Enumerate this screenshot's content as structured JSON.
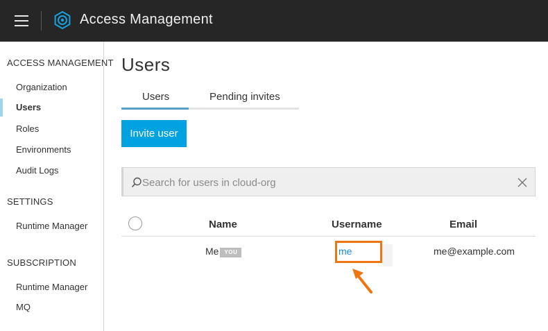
{
  "header": {
    "title": "Access Management",
    "bg_color": "#262626"
  },
  "sidebar": {
    "sections": [
      {
        "heading": "ACCESS MANAGEMENT",
        "items": [
          {
            "label": "Organization",
            "active": false
          },
          {
            "label": "Users",
            "active": true
          },
          {
            "label": "Roles",
            "active": false
          },
          {
            "label": "Environments",
            "active": false
          },
          {
            "label": "Audit Logs",
            "active": false
          }
        ]
      },
      {
        "heading": "SETTINGS",
        "items": [
          {
            "label": "Runtime Manager",
            "active": false
          }
        ]
      },
      {
        "heading": "SUBSCRIPTION",
        "items": [
          {
            "label": "Runtime Manager",
            "active": false
          },
          {
            "label": "MQ",
            "active": false
          }
        ]
      }
    ],
    "active_indicator_color": "#9fd3ee"
  },
  "main": {
    "title": "Users",
    "tabs": [
      {
        "label": "Users",
        "active": true
      },
      {
        "label": "Pending invites",
        "active": false
      }
    ],
    "invite_button_label": "Invite user",
    "search": {
      "placeholder": "Search for users in cloud-org",
      "value": ""
    },
    "table": {
      "columns": [
        "Name",
        "Username",
        "Email"
      ],
      "rows": [
        {
          "name": "Me",
          "badge": "YOU",
          "username": "me",
          "email": "me@example.com"
        }
      ]
    }
  },
  "colors": {
    "accent": "#00a2df",
    "link": "#1a8bd0",
    "annotation": "#f07410"
  },
  "icons": [
    "menu-icon",
    "gear-logo-icon",
    "search-icon",
    "close-icon",
    "arrow-icon"
  ]
}
